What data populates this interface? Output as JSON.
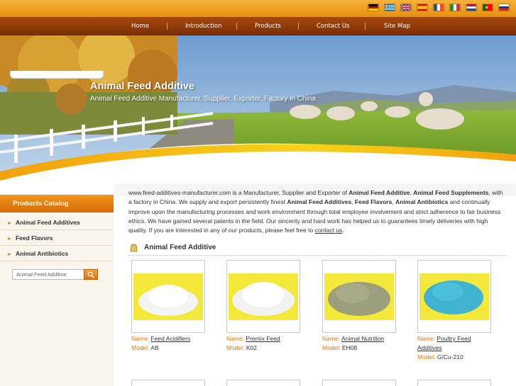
{
  "flags": [
    {
      "icon": "germany-flag-icon",
      "colors": [
        "#000000",
        "#dd0000",
        "#ffce00"
      ]
    },
    {
      "icon": "greece-flag-icon",
      "colors": [
        "#0d5eaf",
        "#ffffff"
      ]
    },
    {
      "icon": "uk-flag-icon",
      "colors": [
        "#012169",
        "#c8102e",
        "#ffffff"
      ]
    },
    {
      "icon": "spain-flag-icon",
      "colors": [
        "#c60b1e",
        "#ffc400"
      ]
    },
    {
      "icon": "france-flag-icon",
      "colors": [
        "#0055a4",
        "#ffffff",
        "#ef4135"
      ]
    },
    {
      "icon": "italy-flag-icon",
      "colors": [
        "#009246",
        "#ffffff",
        "#ce2b37"
      ]
    },
    {
      "icon": "netherlands-flag-icon",
      "colors": [
        "#ae1c28",
        "#ffffff",
        "#21468b"
      ]
    },
    {
      "icon": "portugal-flag-icon",
      "colors": [
        "#006600",
        "#ff0000"
      ]
    },
    {
      "icon": "russia-flag-icon",
      "colors": [
        "#ffffff",
        "#0039a6",
        "#d52b1e"
      ]
    }
  ],
  "nav": {
    "home": "Home",
    "introduction": "Introduction",
    "products": "Products",
    "contact": "Contact Us",
    "sitemap": "Site Map"
  },
  "banner": {
    "title": "Animal Feed Additive",
    "subtitle": "Animal Feed Additive Manufacturer, Supplier, Exporter, Factory in China"
  },
  "catalog": {
    "heading": "Products Catalog",
    "items": [
      "Animal Feed Additives",
      "Feed Flavors",
      "Animal Antibiotics"
    ]
  },
  "search": {
    "placeholder": "Animal Feed Additive",
    "icon": "search-icon"
  },
  "intro": {
    "site": "www.feed-additives-manufacturer.com",
    "t1": " is a Manufacturer, Supplier and Exporter of ",
    "b1": "Animal Feed Additive",
    "t2": ", ",
    "b2": "Animal Feed Supplements",
    "t3": ", with a factory in China. We supply and export persistently finest ",
    "b3": "Animal Feed Additives",
    "t4": ", ",
    "b4": "Feed Flavors",
    "t5": ", ",
    "b5": "Animal Antibiotics",
    "t6": " and continually improve upon the manufacturing processes and work environment through total employee involvement and strict adherence to fair business ethics. We have gained several patents in the field. Our sincerity and hard work has helped us to guarantees timely deliveries with high quality. If you are interested in any of our products, please feel free to ",
    "link": "contact us",
    "t7": "."
  },
  "section": {
    "title": "Animal Feed Additive",
    "icon": "feed-bag-icon"
  },
  "products": [
    {
      "name_label": "Name:",
      "name": "Feed Acidifiers",
      "model_label": "Model:",
      "model": "AB",
      "powder_color": "#f4f4f2"
    },
    {
      "name_label": "Name:",
      "name": "Premix Feed",
      "model_label": "Model:",
      "model": "K02",
      "powder_color": "#f2f2f0"
    },
    {
      "name_label": "Name:",
      "name": "Animal Nutrition",
      "model_label": "Model:",
      "model": "EH08",
      "powder_color": "#9d9e7c"
    },
    {
      "name_label": "Name:",
      "name": "Poultry Feed Additives",
      "model_label": "Model:",
      "model": "G/Cu-210",
      "powder_color": "#3fb3cf"
    }
  ],
  "colors": {
    "accent_orange": "#e07810",
    "nav_brown": "#8a3507",
    "product_bg_yellow": "#f4e83a"
  }
}
